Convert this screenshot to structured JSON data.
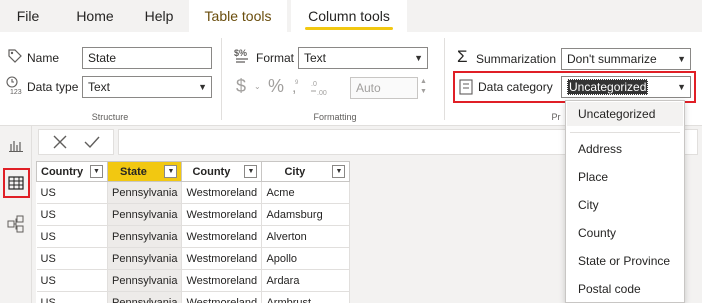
{
  "tabs": [
    "File",
    "Home",
    "Help",
    "Table tools",
    "Column tools"
  ],
  "structure": {
    "name_label": "Name",
    "name_value": "State",
    "datatype_label": "Data type",
    "datatype_value": "Text",
    "group_label": "Structure"
  },
  "formatting": {
    "format_label": "Format",
    "format_value": "Text",
    "dollar": "$",
    "percent": "%",
    "auto": "Auto",
    "group_label": "Formatting"
  },
  "properties": {
    "summarization_label": "Summarization",
    "summarization_value": "Don't summarize",
    "category_label": "Data category",
    "category_value": "Uncategorized",
    "group_label_partial": "Pr"
  },
  "dropdown_items": [
    "Uncategorized",
    "Address",
    "Place",
    "City",
    "County",
    "State or Province",
    "Postal code"
  ],
  "table": {
    "columns": [
      "Country",
      "State",
      "County",
      "City"
    ],
    "rows": [
      [
        "US",
        "Pennsylvania",
        "Westmoreland",
        "Acme"
      ],
      [
        "US",
        "Pennsylvania",
        "Westmoreland",
        "Adamsburg"
      ],
      [
        "US",
        "Pennsylvania",
        "Westmoreland",
        "Alverton"
      ],
      [
        "US",
        "Pennsylvania",
        "Westmoreland",
        "Apollo"
      ],
      [
        "US",
        "Pennsylvania",
        "Westmoreland",
        "Ardara"
      ],
      [
        "US",
        "Pennsylvania",
        "Westmoreland",
        "Armbrust"
      ]
    ]
  },
  "colors": {
    "accent": "#f2c811",
    "highlight_box": "#e01f26",
    "context_tab_text": "#6a4d0c"
  }
}
